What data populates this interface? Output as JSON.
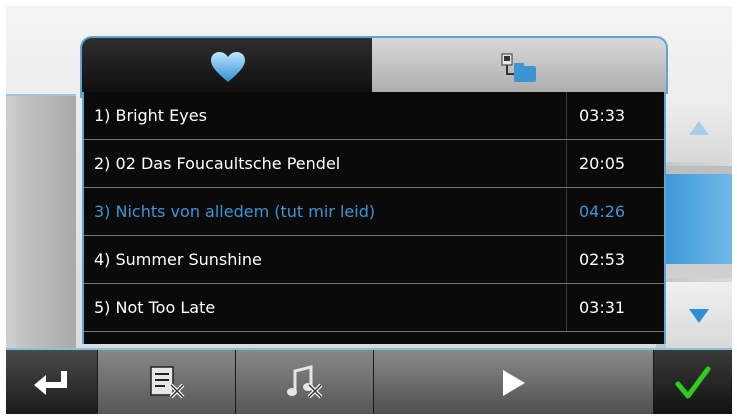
{
  "tabs": [
    {
      "id": "favorites",
      "icon": "heart-icon"
    },
    {
      "id": "browse",
      "icon": "folder-tree-icon"
    }
  ],
  "playlist": [
    {
      "title": "1) Bright Eyes",
      "duration": "03:33",
      "selected": false
    },
    {
      "title": "2) 02 Das Foucaultsche Pendel",
      "duration": "20:05",
      "selected": false
    },
    {
      "title": "3) Nichts von alledem (tut mir leid)",
      "duration": "04:26",
      "selected": true
    },
    {
      "title": "4) Summer Sunshine",
      "duration": "02:53",
      "selected": false
    },
    {
      "title": "5) Not Too Late",
      "duration": "03:31",
      "selected": false
    }
  ],
  "scroll": {
    "position": 0.35
  },
  "toolbar": {
    "buttons": [
      "back-icon",
      "delete-playlist-icon",
      "delete-track-icon",
      "play-icon",
      "checkmark-icon"
    ]
  },
  "colors": {
    "accent": "#3d95d6",
    "frame": "#5fa5d4",
    "list_bg": "#0a0a0a",
    "confirm": "#2ecc1f"
  }
}
